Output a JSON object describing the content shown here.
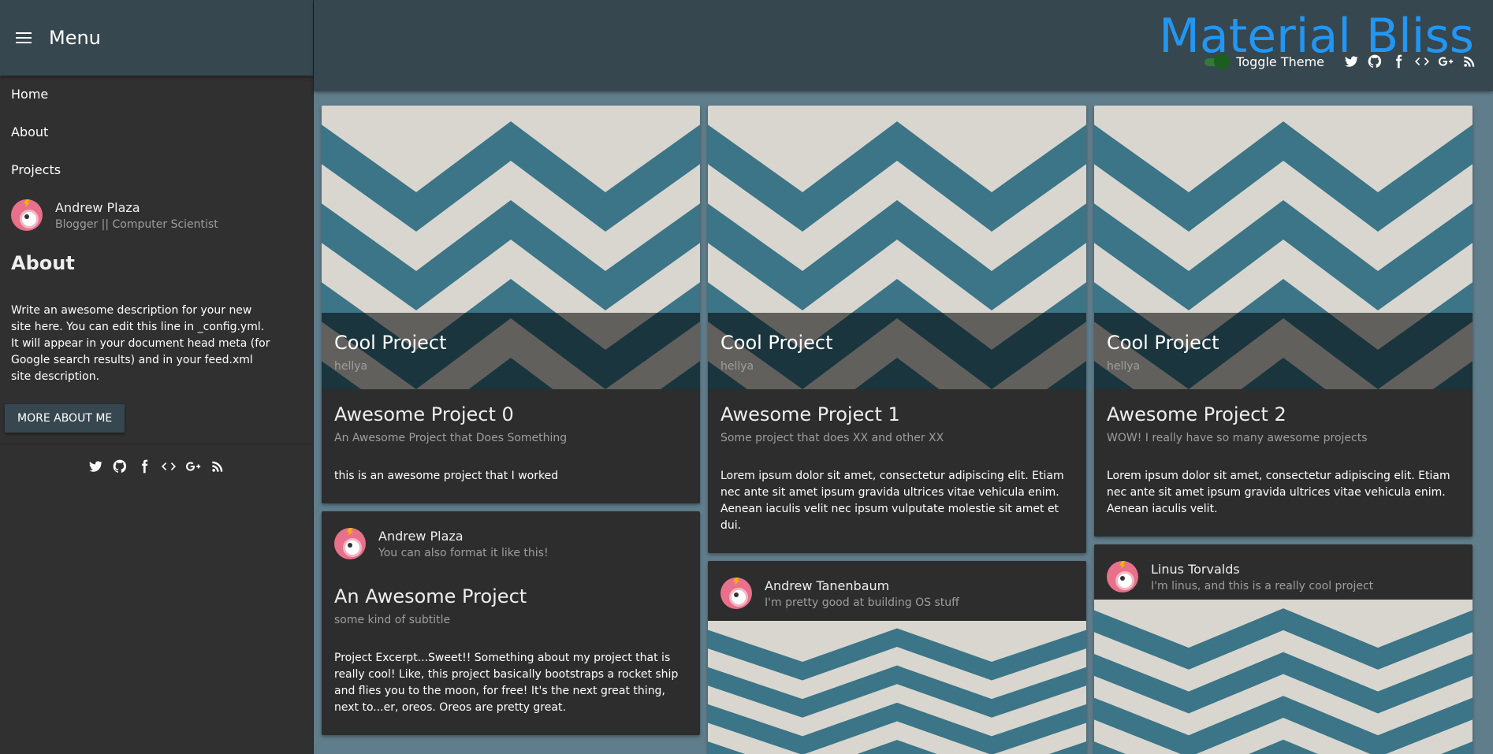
{
  "sidebar": {
    "menu_title": "Menu",
    "nav": [
      "Home",
      "About",
      "Projects"
    ],
    "profile": {
      "name": "Andrew Plaza",
      "subtitle": "Blogger || Computer Scientist"
    },
    "about_heading": "About",
    "about_text": "Write an awesome description for your new site here. You can edit this line in _config.yml. It will appear in your document head meta (for Google search results) and in your feed.xml site description.",
    "more_button": "MORE ABOUT ME",
    "social_icons": [
      "twitter-icon",
      "github-icon",
      "facebook-icon",
      "code-icon",
      "google-plus-icon",
      "rss-icon"
    ]
  },
  "header": {
    "brand": "Material Bliss",
    "toggle_label": "Toggle Theme",
    "social_icons": [
      "twitter-icon",
      "github-icon",
      "facebook-icon",
      "code-icon",
      "google-plus-icon",
      "rss-icon"
    ]
  },
  "colors": {
    "page_bg": "#607d8b",
    "header_bg": "#37474f",
    "sidebar_bg": "#303030",
    "card_bg": "#2d2d2d",
    "brand": "#2196f3",
    "toggle": "#2e7d32"
  },
  "cards": {
    "c0": {
      "image_title": "Cool Project",
      "image_sub": "hellya",
      "title": "Awesome Project 0",
      "subtitle": "An Awesome Project that Does Something",
      "text": "this is an awesome project that I worked"
    },
    "c1": {
      "image_title": "Cool Project",
      "image_sub": "hellya",
      "title": "Awesome Project 1",
      "subtitle": "Some project that does XX and other XX",
      "text": "Lorem ipsum dolor sit amet, consectetur adipiscing elit. Etiam nec ante sit amet ipsum gravida ultrices vitae vehicula enim. Aenean iaculis velit nec ipsum vulputate molestie sit amet et dui."
    },
    "c2": {
      "image_title": "Cool Project",
      "image_sub": "hellya",
      "title": "Awesome Project 2",
      "subtitle": "WOW! I really have so many awesome projects",
      "text": "Lorem ipsum dolor sit amet, consectetur adipiscing elit. Etiam nec ante sit amet ipsum gravida ultrices vitae vehicula enim. Aenean iaculis velit."
    },
    "c3": {
      "author": "Andrew Plaza",
      "author_sub": "You can also format it like this!",
      "title": "An Awesome Project",
      "subtitle": "some kind of subtitle",
      "text": "Project Excerpt...Sweet!! Something about my project that is really cool! Like, this project basically bootstraps a rocket ship and flies you to the moon, for free! It's the next great thing, next to...er, oreos. Oreos are pretty great."
    },
    "c4": {
      "author": "Andrew Tanenbaum",
      "author_sub": "I'm pretty good at building OS stuff"
    },
    "c5": {
      "author": "Linus Torvalds",
      "author_sub": "I'm linus, and this is a really cool project"
    }
  }
}
